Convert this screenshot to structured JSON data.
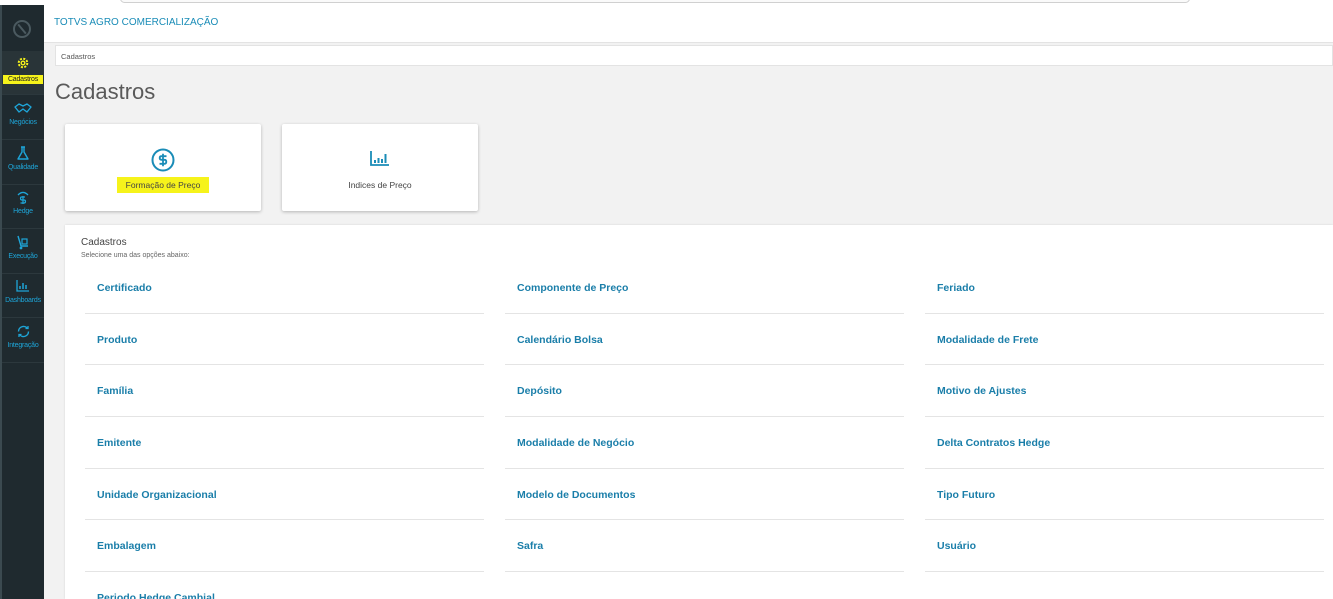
{
  "header": {
    "company": "TOTVS AGRO COMERCIALIZAÇÃO"
  },
  "breadcrumb": {
    "label": "Cadastros"
  },
  "page": {
    "title": "Cadastros"
  },
  "sidebar": {
    "items": [
      {
        "label": "Cadastros",
        "icon": "gear-icon"
      },
      {
        "label": "Negócios",
        "icon": "handshake-icon"
      },
      {
        "label": "Qualidade",
        "icon": "flask-icon"
      },
      {
        "label": "Hedge",
        "icon": "dollar-shield-icon"
      },
      {
        "label": "Execução",
        "icon": "hand-truck-icon"
      },
      {
        "label": "Dashboards",
        "icon": "bar-chart-icon"
      },
      {
        "label": "Integração",
        "icon": "sync-icon"
      }
    ]
  },
  "cards": [
    {
      "label": "Formação de Preço",
      "icon": "dollar-circle-icon"
    },
    {
      "label": "Indices de Preço",
      "icon": "bar-chart-icon"
    }
  ],
  "panel": {
    "title": "Cadastros",
    "subtitle": "Selecione uma das opções abaixo:",
    "columns": [
      [
        "Certificado",
        "Produto",
        "Família",
        "Emitente",
        "Unidade Organizacional",
        "Embalagem",
        "Periodo Hedge Cambial"
      ],
      [
        "Componente de Preço",
        "Calendário Bolsa",
        "Depósito",
        "Modalidade de Negócio",
        "Modelo de Documentos",
        "Safra"
      ],
      [
        "Feriado",
        "Modalidade de Frete",
        "Motivo de Ajustes",
        "Delta Contratos Hedge",
        "Tipo Futuro",
        "Usuário"
      ]
    ]
  },
  "colors": {
    "accent": "#1a7ea9",
    "highlight": "#f6f31b",
    "sidebar": "#1f2a2f"
  }
}
